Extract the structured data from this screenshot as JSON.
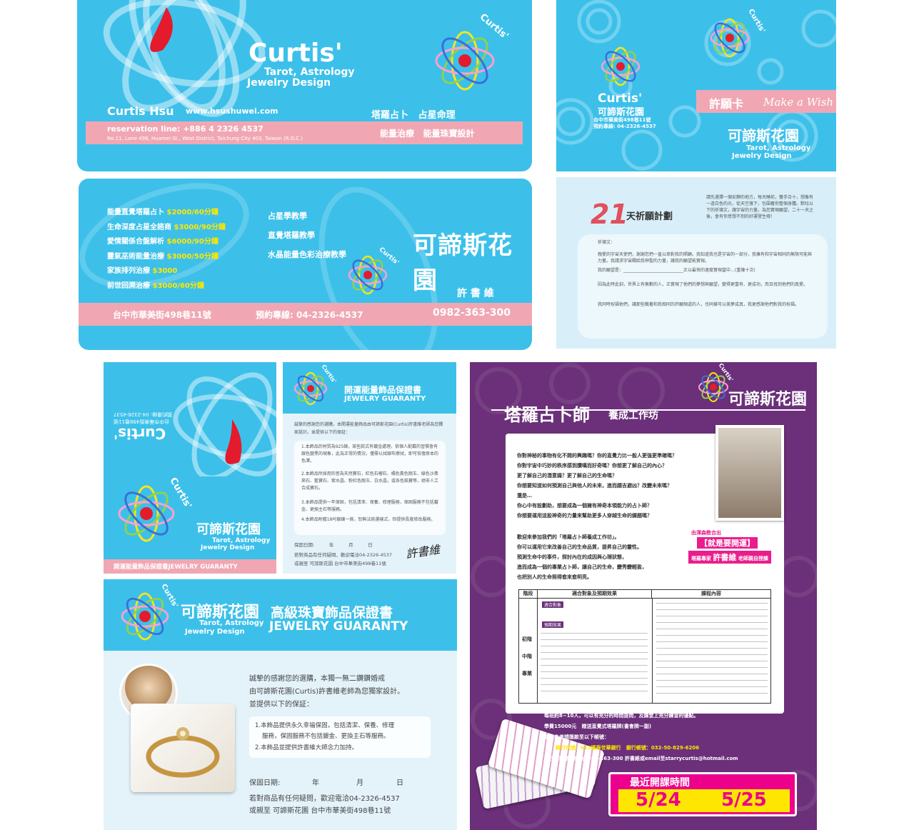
{
  "card_front": {
    "brand": "Curtis'",
    "sub1": "Tarot, Astrology",
    "sub2": "Jewelry Design",
    "name": "Curtis Hsu",
    "website": "www.hsushuwei.com",
    "services1": "塔羅占卜   占星命理",
    "reservation": "reservation line: +886 4 2326 4537",
    "address": "No.11, Lane 498, Huamei St., West District, Taichung City 403, Taiwan (R.O.C.)",
    "services2": "能量治療   能量珠寶設計",
    "flower_label": "Curtis'"
  },
  "card_back": {
    "prices": [
      {
        "name": "能量直覺塔羅占卜",
        "price": "$2000/60分鐘"
      },
      {
        "name": "生命深度占星全諮商",
        "price": "$3000/90分鐘"
      },
      {
        "name": "愛情關係合盤解析",
        "price": "$6000/90分鐘"
      },
      {
        "name": "靈氣巫術能量治療",
        "price": "$3000/50分鐘"
      },
      {
        "name": "家族排列治療",
        "price": "$3000"
      },
      {
        "name": "前世回溯治療",
        "price": "$3000/60分鐘"
      }
    ],
    "courses": [
      "占星學教學",
      "直覺塔羅教學",
      "水晶能量色彩治療教學"
    ],
    "brand_cn": "可諦斯花園",
    "owner": "許 書 維",
    "flower_label": "Curtis'",
    "address": "台中市華美街498巷11號",
    "phone": "預約專線: 04-2326-4537",
    "mobile": "0982-363-300"
  },
  "wish_card": {
    "brand": "Curtis'",
    "brand_cn": "可諦斯花園",
    "addr": "台中市華美街498巷11號",
    "phone": "預約專線: 04-2326-4537",
    "title": "許願卡",
    "title_en": "Make a Wish",
    "brand_cn2": "可諦斯花園",
    "sub1": "Tarot, Astrology",
    "sub2": "Jewelry Design",
    "flower_label": "Curtis'"
  },
  "wish_plan": {
    "num": "21",
    "title": "天祈願計劃",
    "intro": "請先選擇一個安靜的地方，每天睡前，雙手合十，想像有一道白色的光，從天空落下，包圍著你整個身體。默唸以下的祈禱文，讓宇宙的力量，為您實現願望。二十一天之後，會有你意想不到的好運發生唷！",
    "prayer_label": "祈禱文：",
    "prayer1": "親愛的宇宙天使們，謝謝您們一直以來對我的照顧。我知道我也是宇宙的一部分，我擁有和宇宙相同的無限可能與力量。我請求宇宙賜給我神聖的力量，讓我的願望能實現。",
    "prayer2": "我的願望是：____________________________正以最快的速度實現當中…(重複十次)",
    "prayer3": "因為此時此刻，世界上有無數的人，正實現了他們的夢想與願望，變得更富有、更成功，而且找到他們的真愛。",
    "prayer4": "我同時祝福他們，讓那些載著和我相同的許願頻道的人，也同樣可以美夢成真，我更感謝他們對我的祝福。"
  },
  "jewel_small": {
    "rot_brand": "Curtis'",
    "rot_addr": "台中市華美街498巷11號",
    "rot_phone": "預約專線: 04-2326-4537",
    "flower_label": "Curtis'",
    "brand_cn": "可諦斯花園",
    "sub1": "Tarot, Astrology",
    "sub2": "Jewelry Design",
    "bar": "開運能量飾品保證書JEWELRY GUARANTY"
  },
  "jewel_cert1": {
    "title": "開運能量飾品保證書",
    "title_en": "JEWELRY GUARANTY",
    "flower_label": "Curtis'",
    "intro": "誠摯的感謝您的選購，本開運能量飾品由可諦斯花園(Curtis)許書維老師為您獨家設計。並提供以下的保証：",
    "items": [
      "1.本飾品的材質為925銀，某些款式有鍍金處理，依個人配戴的習慣會有銀色變黑的現象，此為正常的情況，僅需以拭銀布擦拭，即可恢復原本的色澤。",
      "2.本飾品所採用的皆為天然寶石，紅色石榴石、橘色黃色剛玉、綠色沙弗來石、藍寶石、紫水晶、粉紅色剛玉、白水晶，或各色鋯寶等，絕非人工合成寶石。",
      "3.本飾品提供一年保固，包括清潔、保養、修理服務，保固服務不包括鍍金、更換主石等服務。",
      "4.本飾品附贈18吋銀鍊一條，恕無法挑選樣式，但提供長度修改服務。"
    ],
    "date": "保固日期:          年          月          日",
    "contact1": "若對商品有任何疑問，歡迎電洽04-2326-4537",
    "contact2": "或親至 可諦斯花園  台中市華美街498巷11號",
    "signature": "許書維"
  },
  "jewel_cert2": {
    "brand_cn": "可諦斯花園",
    "sub1": "Tarot, Astrology",
    "sub2": "Jewelry Design",
    "flower_label": "Curtis'",
    "title": "高級珠寶飾品保證書",
    "title_en": "JEWELRY GUARANTY",
    "intro1": "誠摯的感謝您的選購，本獨一無二鑽鑽婚戒",
    "intro2": "由可諦斯花園(Curtis)許書維老師為您獨家設計。",
    "intro3": "並提供以下的保証：",
    "item1a": "1.本飾品提供永久幸福保固，包括清潔、保養、修理",
    "item1b": "服務，保固服務不包括鍍金、更換主石等服務。",
    "item2": "2.本飾品並提供許書維大師念力加持。",
    "date_label": "保固日期:",
    "date_y": "年",
    "date_m": "月",
    "date_d": "日",
    "contact1": "若對商品有任何疑問，歡迎電洽04-2326-4537",
    "contact2": "或親至 可諦斯花園  台中市華美街498巷11號"
  },
  "tarot_flyer": {
    "flower_label": "Curtis'",
    "brand_cn": "可諦斯花園",
    "title": "塔羅占卜師",
    "title2": "養成工作坊",
    "qs": [
      "你對神秘的事物有化不開的興趣嗎？你的直覺力比一般人更強更準確嗎？",
      "你對宇宙中巧妙的秩序感到讚嘆而好奇嗎？你想更了解自己的內心？",
      "更了解自己的潛意識？更了解自己的生命嗎？",
      "你想要知道如何預測自己與他人的未來，進而趨吉避凶？改變未來嗎？",
      "還是…",
      "你心中有設劃助，想要成為一個擁有神奇本領能力的占卜師？",
      "你想要運用這股神奇的力量來幫助更多人穿越生命的課題嗎？"
    ],
    "invite": [
      "歡迎來參加我們的「塔羅占卜師養成工作坊」。",
      "你可以運用它來改善自己的生命品質，提昇自己的靈性。",
      "預測生命中的事件，探討內在的成因與心理狀態，",
      "進而成為一個的專業占卜師，讓自己的生命，變秀變輕盈，",
      "也把別人的生命照得愈來愈明亮。"
    ],
    "badge1": "由渾森教合出",
    "badge2": "【就是要開運】",
    "badge3": "塔羅專家",
    "badge_name": "許書維",
    "badge4": "老師親自授課",
    "table_headers": [
      "階段",
      "適合對象及預期效果",
      "課程內容"
    ],
    "table_rows": [
      "初階",
      "中階",
      "專業"
    ],
    "table_tag1": "適合對象",
    "table_tag2": "預期效果",
    "bullets": [
      "每班約8~10人，可以有充分的時間提問，及課堂上充分練習的優點。",
      "學費15000元   贈送直覺式塔羅牌(書會牌一副)",
      "請報名者請匯款至以下帳號：",
      "銀行代號：013國泰世華銀行   銀行帳號：032-50-829-6206",
      "有任何問題，請洽0982-363-300 許書維或email至starrycurtis@hotmail.com"
    ],
    "date_title": "最近開課時間",
    "date1": "5/24",
    "date2": "5/25"
  }
}
